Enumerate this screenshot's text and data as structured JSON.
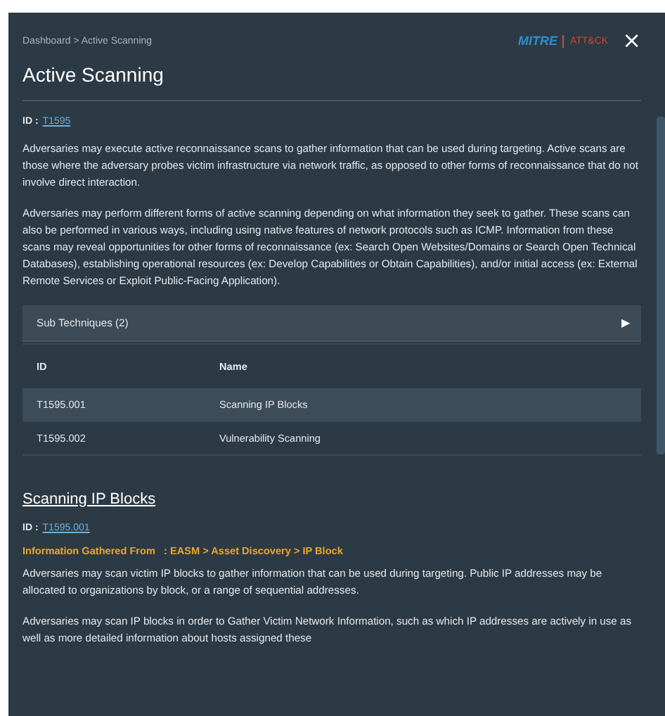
{
  "breadcrumb": {
    "items": [
      "Dashboard",
      "Active Scanning"
    ],
    "separator": ">"
  },
  "logo": {
    "left": "MITRE",
    "right": "ATT&CK"
  },
  "close": "×",
  "title": "Active Scanning",
  "id": {
    "label": "ID :",
    "value": "T1595"
  },
  "paragraphs": [
    "Adversaries may execute active reconnaissance scans to gather information that can be used during targeting. Active scans are those where the adversary probes victim infrastructure via network traffic, as opposed to other forms of reconnaissance that do not involve direct interaction.",
    "Adversaries may perform different forms of active scanning depending on what information they seek to gather. These scans can also be performed in various ways, including using native features of network protocols such as ICMP. Information from these scans may reveal opportunities for other forms of reconnaissance (ex: Search Open Websites/Domains or Search Open Technical Databases), establishing operational resources (ex: Develop Capabilities or Obtain Capabilities), and/or initial access (ex: External Remote Services or Exploit Public-Facing Application)."
  ],
  "sub_techniques": {
    "label": "Sub Techniques (2)",
    "expand_glyph": "▶",
    "columns": [
      "ID",
      "Name"
    ],
    "rows": [
      {
        "id": "T1595.001",
        "name": "Scanning IP Blocks",
        "selected": true
      },
      {
        "id": "T1595.002",
        "name": "Vulnerability Scanning",
        "selected": false
      }
    ]
  },
  "section": {
    "title": "Scanning IP Blocks",
    "id_label": "ID :",
    "id_value": "T1595.001",
    "info": "Information Gathered From   : EASM > Asset Discovery > IP Block",
    "paragraphs": [
      "Adversaries may scan victim IP blocks to gather information that can be used during targeting. Public IP addresses may be allocated to organizations by block, or a range of sequential addresses.",
      "Adversaries may scan IP blocks in order to Gather Victim Network Information, such as which IP addresses are actively in use as well as more detailed information about hosts assigned these"
    ]
  }
}
